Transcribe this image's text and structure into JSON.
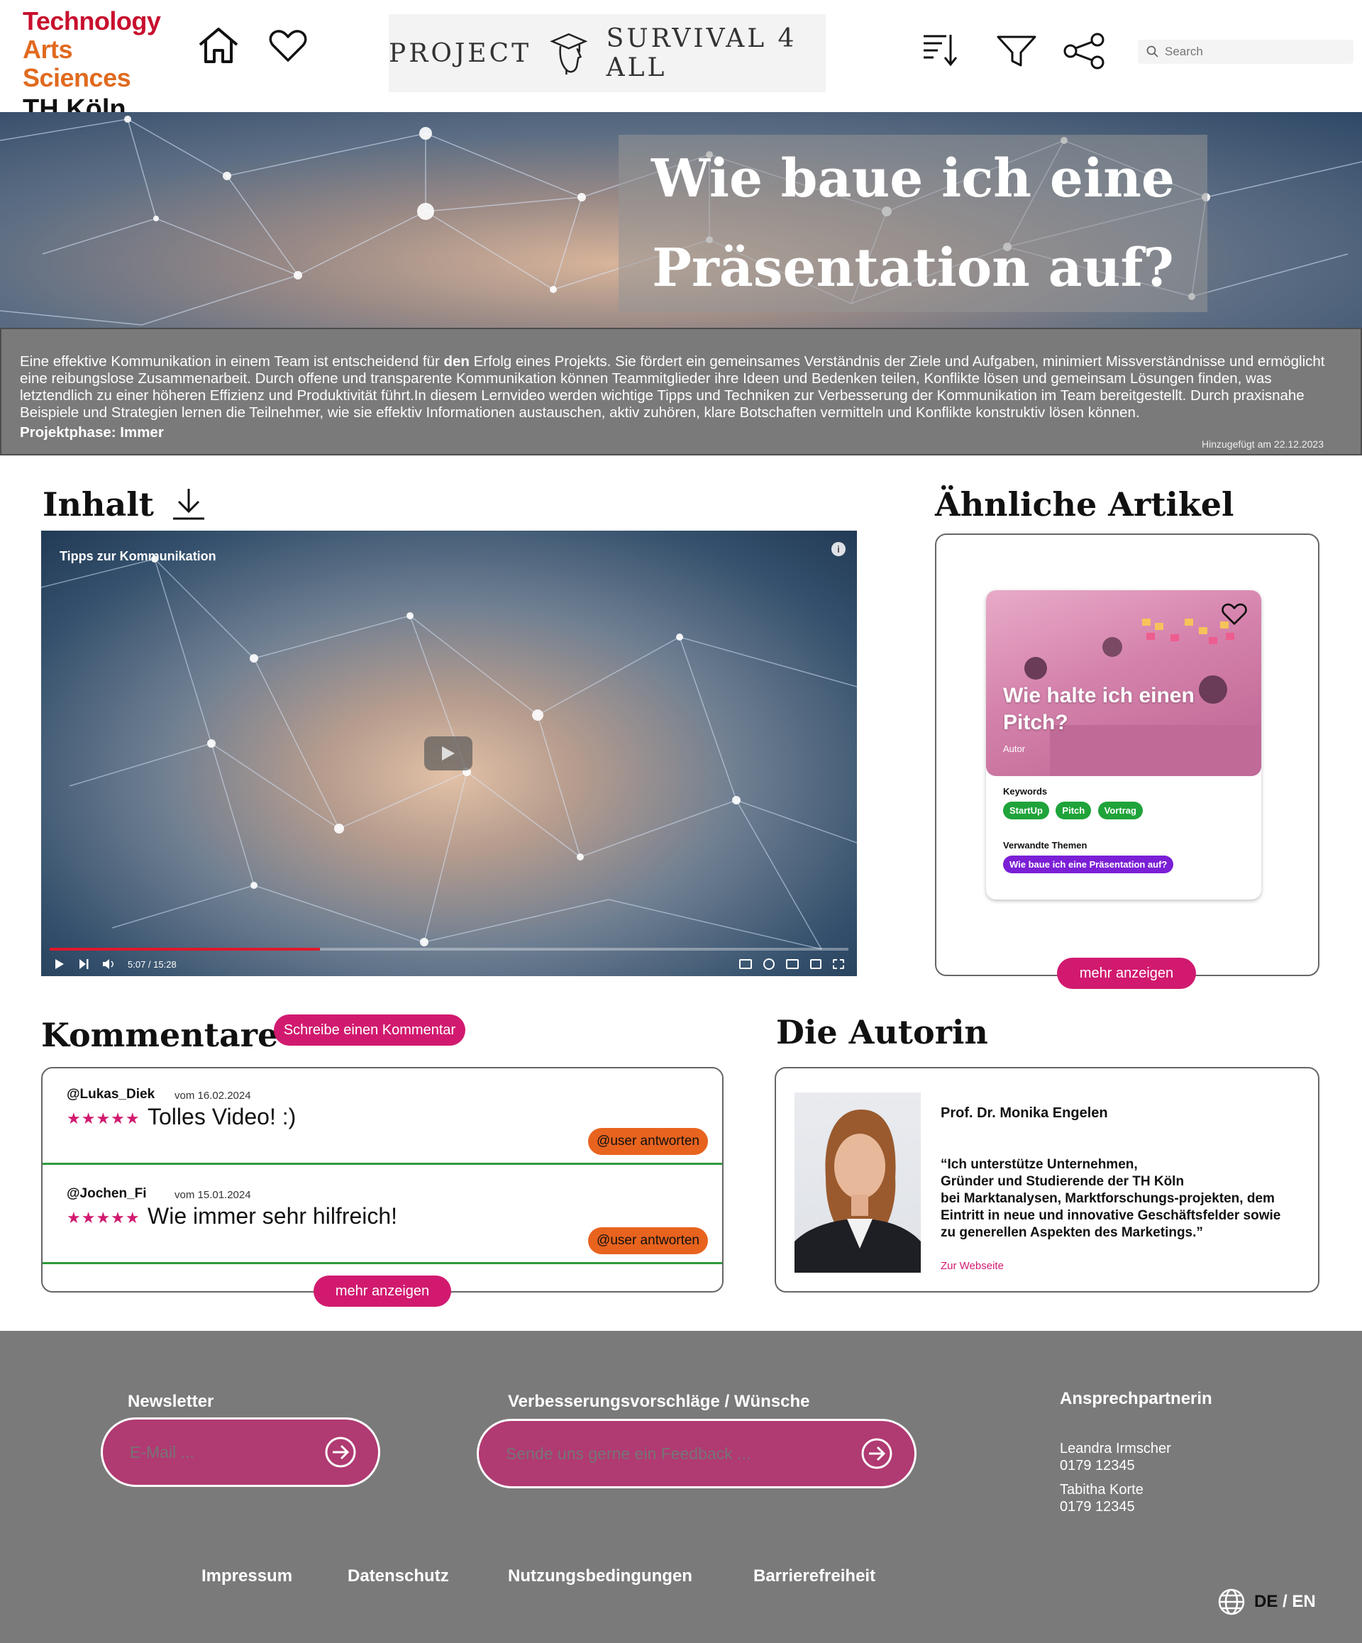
{
  "header": {
    "logo": {
      "line1": "Technology",
      "line2": "Arts Sciences",
      "line3": "TH Köln"
    },
    "brand": {
      "left": "PROJECT",
      "right": "SURVIVAL 4 ALL"
    },
    "search": {
      "placeholder": "Search"
    }
  },
  "hero": {
    "title_line1": "Wie baue ich eine",
    "title_line2": "Präsentation auf?",
    "description_pre": "Eine effektive Kommunikation in einem Team ist entscheidend für ",
    "description_bold": "den",
    "description_post": " Erfolg eines Projekts. Sie fördert ein gemeinsames Verständnis der Ziele und Aufgaben, minimiert Missverständnisse und ermöglicht eine reibungslose Zusammenarbeit. Durch offene und transparente Kommunikation können Teammitglieder ihre Ideen und Bedenken teilen, Konflikte lösen und gemeinsam Lösungen finden, was letztendlich zu einer höheren Effizienz und Produktivität führt.In diesem Lernvideo werden wichtige Tipps und Techniken zur Verbesserung der Kommunikation im Team bereitgestellt. Durch praxisnahe Beispiele und Strategien lernen die Teilnehmer, wie sie effektiv Informationen austauschen, aktiv zuhören, klare Botschaften vermitteln und Konflikte konstruktiv lösen können.",
    "phase": "Projektphase: Immer",
    "added": "Hinzugefügt am 22.12.2023"
  },
  "content": {
    "heading": "Inhalt",
    "video": {
      "title": "Tipps zur Kommunikation",
      "time": "5:07 / 15:28",
      "progress": 0.338
    }
  },
  "similar": {
    "heading": "Ähnliche Artikel",
    "card": {
      "title": "Wie halte ich einen Pitch?",
      "author": "Autor",
      "keywords_label": "Keywords",
      "keywords": [
        "StartUp",
        "Pitch",
        "Vortrag"
      ],
      "related_label": "Verwandte Themen",
      "related": "Wie baue ich eine Präsentation auf?"
    },
    "more": "mehr anzeigen"
  },
  "comments": {
    "heading": "Kommentare",
    "write": "Schreibe einen Kommentar",
    "items": [
      {
        "user": "@Lukas_Diek",
        "date": "vom 16.02.2024",
        "stars": "★★★★★",
        "text": "Tolles Video! :)",
        "reply": "@user antworten"
      },
      {
        "user": "@Jochen_Fi",
        "date": "vom 15.01.2024",
        "stars": "★★★★★",
        "text": "Wie immer sehr hilfreich!",
        "reply": "@user antworten"
      }
    ],
    "more": "mehr anzeigen"
  },
  "author": {
    "heading": "Die Autorin",
    "name": "Prof. Dr. Monika Engelen",
    "quote_l1": "“Ich unterstütze Unternehmen,",
    "quote_l2": "Gründer und Studierende der TH Köln",
    "quote_l3": "bei Marktanalysen, Marktforschungs-projekten, dem",
    "quote_l4": "Eintritt in neue und innovative Geschäftsfelder sowie",
    "quote_l5": "zu generellen Aspekten des Marketings.”",
    "link": "Zur Webseite"
  },
  "footer": {
    "newsletter_label": "Newsletter",
    "newsletter_placeholder": "E-Mail ...",
    "feedback_label": "Verbesserungsvorschläge / Wünsche",
    "feedback_placeholder": "Sende uns gerne ein Feedback ...",
    "contact_label": "Ansprechpartnerin",
    "contacts": [
      {
        "name": "Leandra Irmscher",
        "phone": "0179 12345"
      },
      {
        "name": "Tabitha Korte",
        "phone": "0179 12345"
      }
    ],
    "links": [
      "Impressum",
      "Datenschutz",
      "Nutzungsbedingungen",
      "Barrierefreiheit"
    ],
    "lang_active": "DE",
    "lang_sep": " / ",
    "lang_other": "EN"
  },
  "colors": {
    "accent": "#d11a6f",
    "green": "#1fa33a",
    "orange": "#e8631e",
    "footer": "#7a7a7a"
  }
}
